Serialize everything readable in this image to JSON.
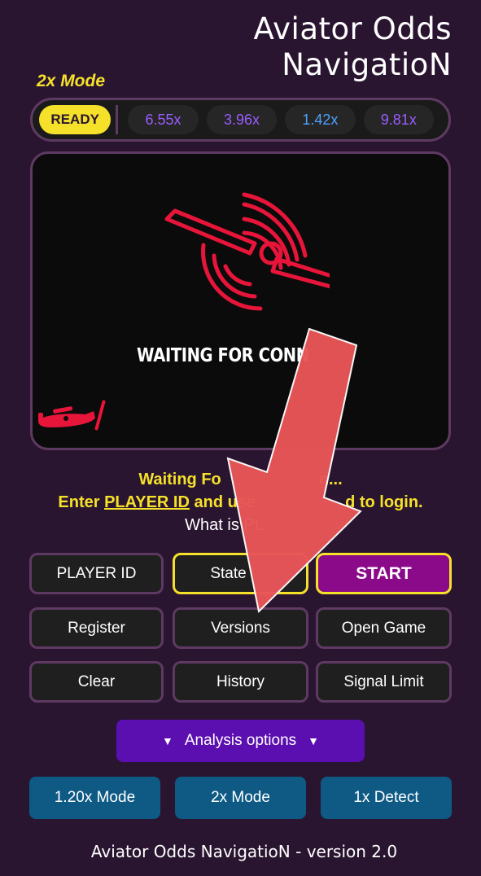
{
  "header": {
    "title_line1": "Aviator Odds",
    "title_line2": "NavigatioN"
  },
  "mode": {
    "label": "2x Mode"
  },
  "odds_bar": {
    "status": "READY",
    "odds": [
      "6.55x",
      "3.96x",
      "1.42x",
      "9.81x"
    ]
  },
  "game": {
    "waiting_text": "WAITING FOR CONN"
  },
  "status": {
    "line1": "Waiting Fo",
    "line1_end": "n...",
    "line2_start": "Enter ",
    "player_id": "PLAYER ID",
    "line2_mid": " and use",
    "line2_end": "d to login.",
    "line3": "What is PL"
  },
  "buttons": {
    "player_id": "PLAYER ID",
    "state": "State",
    "start": "START",
    "register": "Register",
    "versions": "Versions",
    "open_game": "Open Game",
    "clear": "Clear",
    "history": "History",
    "signal_limit": "Signal Limit"
  },
  "analysis": {
    "label": "Analysis options",
    "icon": "triangle-down-icon"
  },
  "modes": [
    "1.20x Mode",
    "2x Mode",
    "1x Detect"
  ],
  "footer": {
    "text": "Aviator Odds NavigatioN -  version 2.0"
  },
  "colors": {
    "background": "#2a1530",
    "accent_yellow": "#f5e12a",
    "accent_red": "#e8153a",
    "start_purple": "#8a0a8a",
    "analysis_purple": "#5b0fb0",
    "mode_blue": "#0e5a85",
    "arrow_red": "#e85558"
  }
}
